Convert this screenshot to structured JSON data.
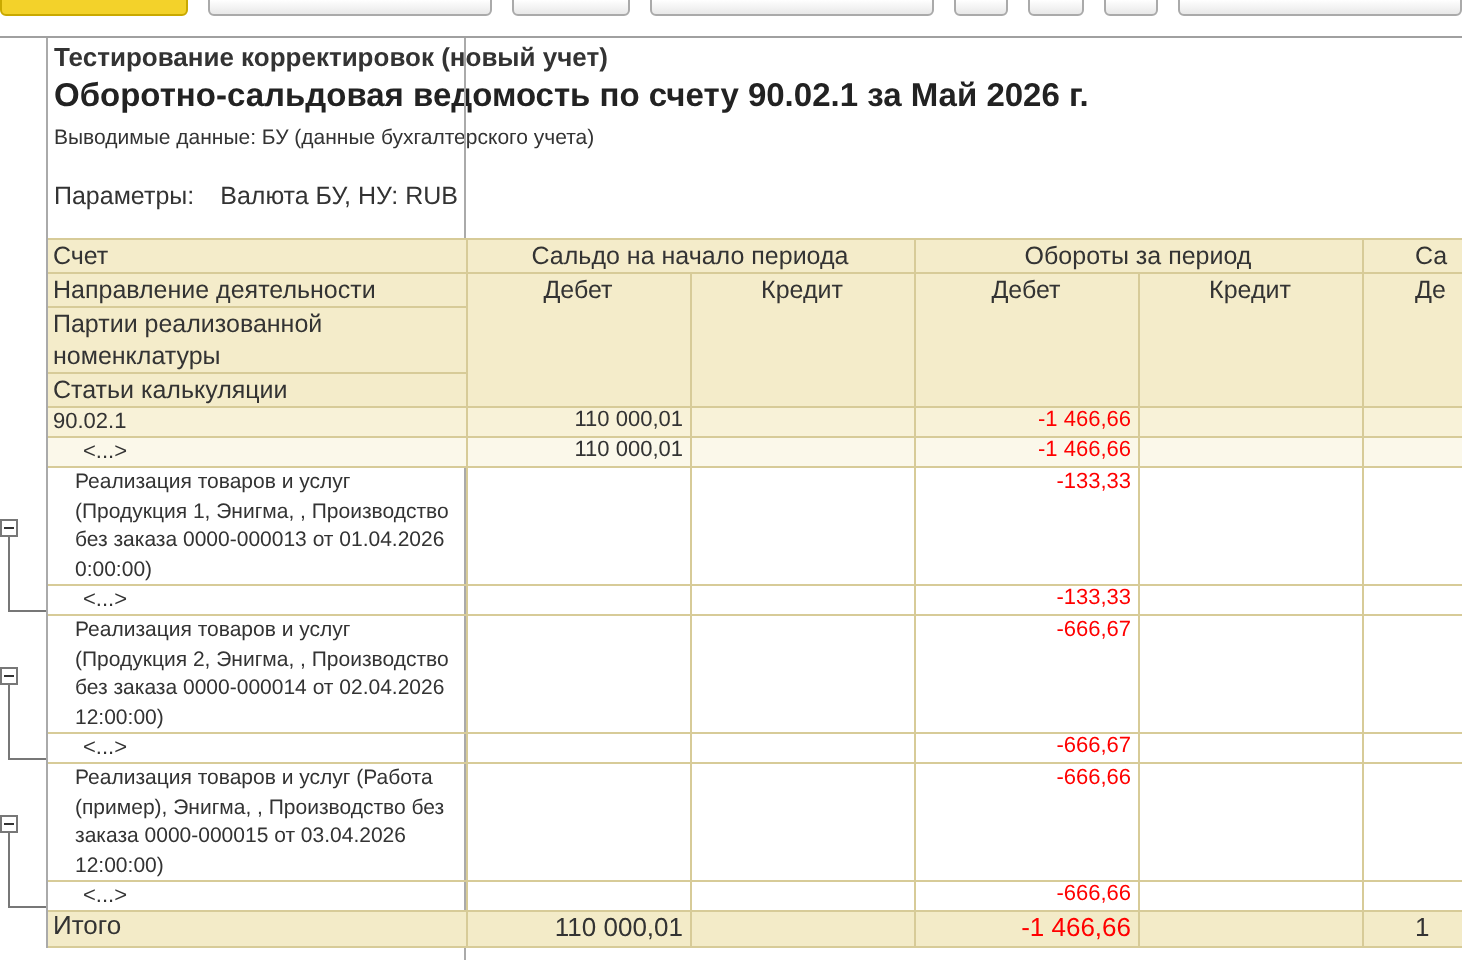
{
  "toolbar": {
    "buttons": [
      {
        "kind": "primary"
      },
      {
        "kind": "plain"
      },
      {
        "kind": "nav"
      },
      {
        "kind": "plain"
      },
      {
        "kind": "icon"
      },
      {
        "kind": "icon"
      },
      {
        "kind": "icon"
      },
      {
        "kind": "plain"
      }
    ]
  },
  "report": {
    "title": "Тестирование корректировок (новый учет)",
    "heading": "Оборотно-сальдовая ведомость по счету 90.02.1 за Май 2026 г.",
    "output_note": "Выводимые данные: БУ (данные бухгалтерского учета)",
    "params_label": "Параметры:",
    "params_value": "Валюта БУ, НУ: RUB"
  },
  "table": {
    "row_headers": [
      "Счет",
      "Направление деятельности",
      "Партии реализованной номенклатуры",
      "Статьи калькуляции"
    ],
    "column_groups": [
      {
        "label": "Сальдо на начало периода",
        "debit": "Дебет",
        "credit": "Кредит"
      },
      {
        "label": "Обороты за период",
        "debit": "Дебет",
        "credit": "Кредит"
      },
      {
        "label": "Са",
        "debit": "Де"
      }
    ],
    "rows": [
      {
        "kind": "account",
        "label": "90.02.1",
        "opening_debit": "110 000,01",
        "turnover_debit": "-1 466,66",
        "turnover_negative": true
      },
      {
        "kind": "group",
        "label": "<...>",
        "opening_debit": "110 000,01",
        "turnover_debit": "-1 466,66",
        "turnover_negative": true
      },
      {
        "kind": "detail",
        "expanded": true,
        "label": "Реализация товаров и услуг (Продукция 1, Энигма, , Производство без заказа 0000-000013 от 01.04.2026 0:00:00)",
        "turnover_debit": "-133,33",
        "turnover_negative": true
      },
      {
        "kind": "subgroup",
        "label": "<...>",
        "turnover_debit": "-133,33",
        "turnover_negative": true
      },
      {
        "kind": "detail",
        "expanded": true,
        "label": "Реализация товаров и услуг (Продукция 2, Энигма, , Производство без заказа 0000-000014 от 02.04.2026 12:00:00)",
        "turnover_debit": "-666,67",
        "turnover_negative": true
      },
      {
        "kind": "subgroup",
        "label": "<...>",
        "turnover_debit": "-666,67",
        "turnover_negative": true
      },
      {
        "kind": "detail",
        "expanded": true,
        "label": "Реализация товаров и услуг (Работа (пример), Энигма, , Производство без заказа 0000-000015 от 03.04.2026 12:00:00)",
        "turnover_debit": "-666,66",
        "turnover_negative": true
      },
      {
        "kind": "subgroup",
        "label": "<...>",
        "turnover_debit": "-666,66",
        "turnover_negative": true
      },
      {
        "kind": "total",
        "label": "Итого",
        "opening_debit": "110 000,01",
        "turnover_debit": "-1 466,66",
        "turnover_negative": true,
        "column_7": "1"
      }
    ]
  }
}
